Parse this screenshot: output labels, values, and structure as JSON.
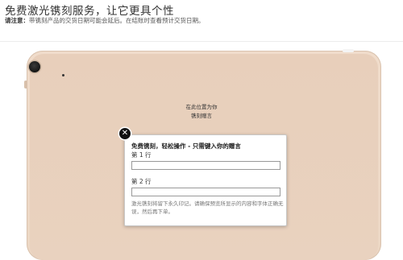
{
  "header": {
    "title": "免费激光镌刻服务，让它更具个性",
    "notice_label": "请注意：",
    "notice_text": "带镌刻产品的交货日期可能会延后。在结账时查看预计交货日期。"
  },
  "preview": {
    "line1": "在此位置为你",
    "line2": "镌刻赠言"
  },
  "popup": {
    "close_glyph": "✕",
    "heading": "免费镌刻，轻松操作 - 只需键入你的赠言",
    "line1_label": "第 1 行",
    "line1_value": "",
    "line2_label": "第 2 行",
    "line2_value": "",
    "disclaimer": "激光镌刻将留下永久印记。请确保预览所显示的内容和字体正确无误，然后再下单。"
  },
  "colors": {
    "device_gold": "#ecd7c4",
    "close_button": "#111111"
  },
  "icons": [
    "close-icon",
    "camera-icon"
  ]
}
